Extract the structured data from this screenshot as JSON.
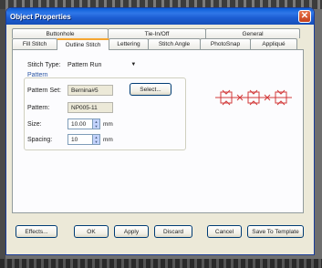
{
  "window": {
    "title": "Object Properties"
  },
  "tabs": {
    "upper": [
      "Buttonhole",
      "Tie-In/Off",
      "General"
    ],
    "lower": [
      "Fill Stitch",
      "Outline Stitch",
      "Lettering",
      "Stitch Angle",
      "PhotoSnap",
      "Appliqué"
    ],
    "active": "Outline Stitch"
  },
  "form": {
    "stitch_type_label": "Stitch Type:",
    "stitch_type_value": "Pattern Run",
    "pattern_group_title": "Pattern",
    "pattern_set_label": "Pattern Set:",
    "pattern_set_value": "Bernina#5",
    "select_button": "Select...",
    "pattern_label": "Pattern:",
    "pattern_value": "NP005-11",
    "size_label": "Size:",
    "size_value": "10.00",
    "size_unit": "mm",
    "spacing_label": "Spacing:",
    "spacing_value": "10",
    "spacing_unit": "mm"
  },
  "buttons": {
    "effects": "Effects...",
    "ok": "OK",
    "apply": "Apply",
    "discard": "Discard",
    "cancel": "Cancel",
    "save_template": "Save To Template"
  },
  "colors": {
    "titlebar": "#1c5dd2",
    "accent_tab": "#f5a631",
    "pattern_preview": "#d23a3a"
  }
}
